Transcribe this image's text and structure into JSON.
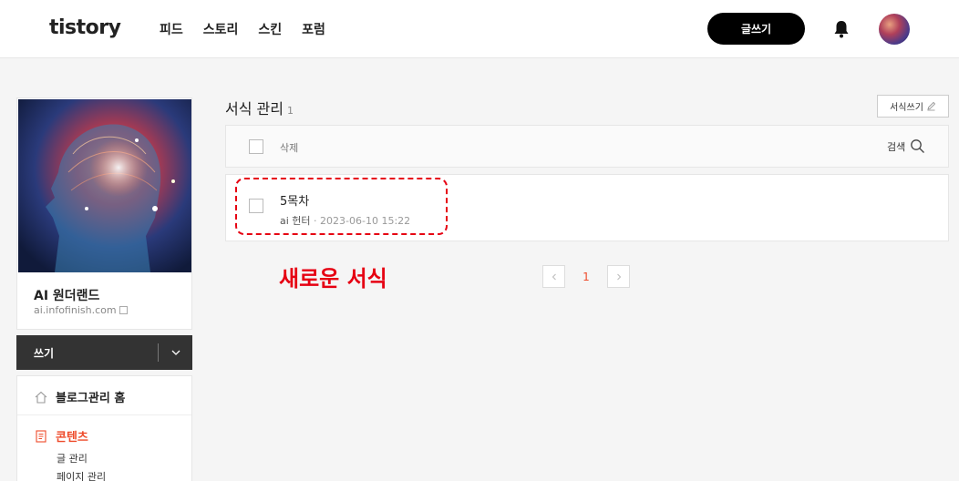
{
  "header": {
    "logo": "tistory",
    "nav": [
      "피드",
      "스토리",
      "스킨",
      "포럼"
    ],
    "write_button": "글쓰기"
  },
  "sidebar": {
    "blog_name": "AI 원더랜드",
    "blog_url": "ai.infofinish.com",
    "write_label": "쓰기",
    "menu_home": "블로그관리 홈",
    "menu_content": "콘텐츠",
    "sub_items": [
      "글 관리",
      "페이지 관리"
    ]
  },
  "main": {
    "title": "서식 관리",
    "count": "1",
    "new_button": "서식쓰기",
    "delete_label": "삭제",
    "search_label": "검색",
    "rows": [
      {
        "title": "5목차",
        "author": "ai 헌터",
        "date": "2023-06-10 15:22"
      }
    ],
    "annotation": "새로운 서식",
    "pagination": {
      "current": "1"
    }
  },
  "colors": {
    "accent": "#ee4b2b",
    "annotation": "#e60012"
  }
}
